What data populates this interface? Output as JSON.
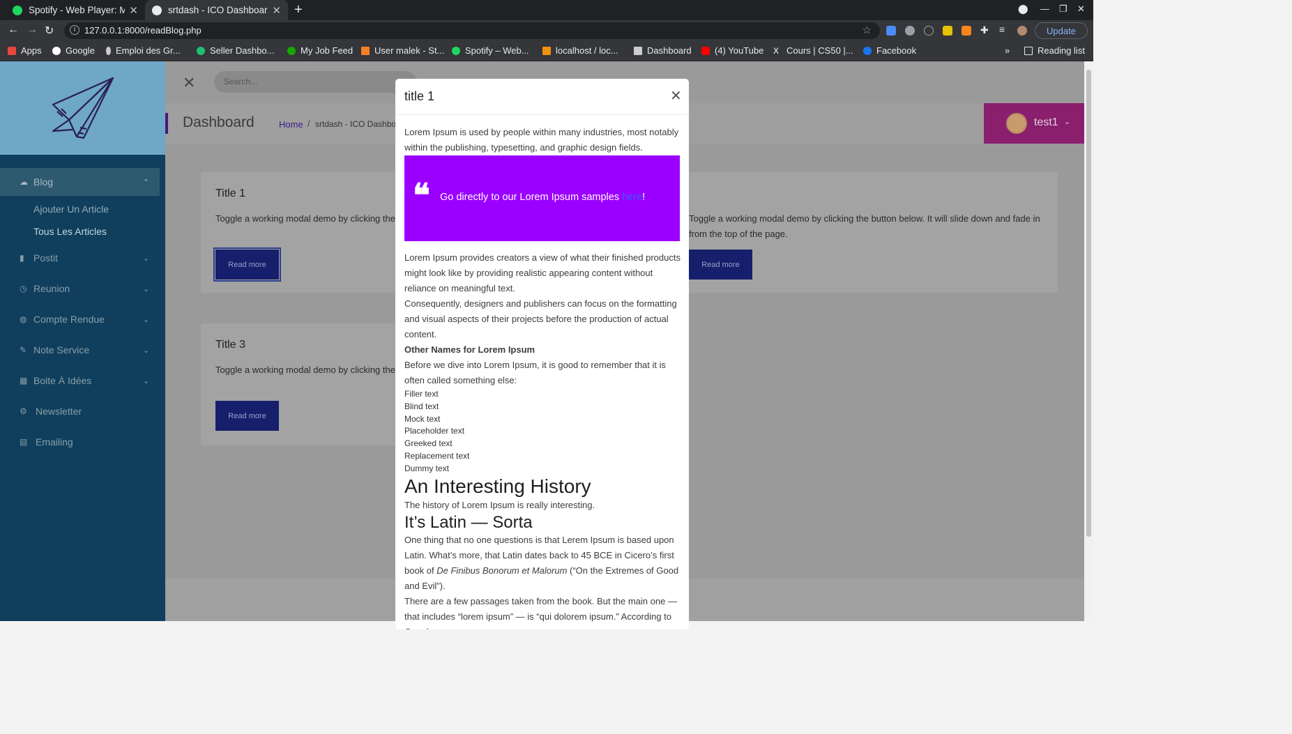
{
  "browser": {
    "tabs": [
      {
        "label": "Spotify - Web Player: Musi",
        "active": false,
        "favicon_color": "#1ed760"
      },
      {
        "label": "srtdash - ICO Dashboard",
        "active": true,
        "favicon_color": "#e8eaed"
      }
    ],
    "url": "127.0.0.1:8000/readBlog.php",
    "update_label": "Update",
    "bookmarks": [
      {
        "label": "Apps",
        "icon_color": "#e8453c"
      },
      {
        "label": "Google",
        "icon_color": "#ffffff"
      },
      {
        "label": "Emploi des Gr...",
        "icon_color": "#cccccc"
      },
      {
        "label": "Seller Dashbo...",
        "icon_color": "#1dbf73"
      },
      {
        "label": "My Job Feed",
        "icon_color": "#14a800"
      },
      {
        "label": "User malek - St...",
        "icon_color": "#f48024"
      },
      {
        "label": "Spotify – Web...",
        "icon_color": "#1ed760"
      },
      {
        "label": "localhost / loc...",
        "icon_color": "#f29111"
      },
      {
        "label": "Dashboard",
        "icon_color": "#cccccc"
      },
      {
        "label": "(4) YouTube",
        "icon_color": "#ff0000"
      },
      {
        "label": "Cours | CS50 |...",
        "icon_color": "#ffffff"
      },
      {
        "label": "Facebook",
        "icon_color": "#1877f2"
      }
    ],
    "reading_list": "Reading list"
  },
  "sidebar": {
    "items": [
      {
        "label": "Blog",
        "icon": "cloud-icon",
        "expanded": true
      },
      {
        "label": "Postit",
        "icon": "bookmark-icon"
      },
      {
        "label": "Reunion",
        "icon": "clock-icon"
      },
      {
        "label": "Compte Rendue",
        "icon": "palette-icon"
      },
      {
        "label": "Note Service",
        "icon": "pen-icon"
      },
      {
        "label": "Boite À Idées",
        "icon": "grid-icon"
      },
      {
        "label": "Newsletter",
        "icon": "gear-icon"
      },
      {
        "label": "Emailing",
        "icon": "list-icon"
      }
    ],
    "blog_subitems": [
      "Ajouter Un Article",
      "Tous Les Articles"
    ]
  },
  "topbar": {
    "search_placeholder": "Search..."
  },
  "pagehead": {
    "title": "Dashboard",
    "breadcrumb_home": "Home",
    "breadcrumb_sep": "/",
    "breadcrumb_current": "srtdash - ICO Dashboa"
  },
  "user": {
    "name": "test1"
  },
  "cards": [
    {
      "title": "Title 1",
      "text": "Toggle a working modal demo by clicking the button below. It will slide down and fade in from the top of the page.",
      "button": "Read more"
    },
    {
      "title": "Title 3",
      "text": "Toggle a working modal demo by clicking the button below. It will slide down and fade in from the top of the page.",
      "button": "Read more"
    },
    {
      "text": "Toggle a working modal demo by clicking the button below. It will slide down and fade in from the top of the page.",
      "button": "Read more"
    }
  ],
  "modal": {
    "title": "title 1",
    "intro": "Lorem Ipsum is used by people within many industries, most notably within the publishing, typesetting, and graphic design fields.",
    "quote_text": "Go directly to our Lorem Ipsum samples ",
    "quote_link": "here",
    "quote_end": "!",
    "p1": "Lorem Ipsum provides creators a view of what their finished products might look like by providing realistic appearing content without reliance on meaningful text.",
    "p2": "Consequently, designers and publishers can focus on the formatting and visual aspects of their projects before the production of actual content.",
    "other_names_heading": "Other Names for Lorem Ipsum",
    "p3": "Before we dive into Lorem Ipsum, it is good to remember that it is often called something else:",
    "names": [
      "Filler text",
      "Blind text",
      "Mock text",
      "Placeholder text",
      "Greeked text",
      "Replacement text",
      "Dummy text"
    ],
    "h_history": "An Interesting History",
    "p_history": "The history of Lorem Ipsum is really interesting.",
    "h_latin": "It’s Latin — Sorta",
    "p_latin_a": "One thing that no one questions is that Lerem Ipsum is based upon Latin. What’s more, that Latin dates back to 45 BCE in Cicero’s first book of ",
    "p_latin_em": "De Finibus Bonorum et Malorum",
    "p_latin_b": " (“On the Extremes of Good and Evil”).",
    "p_last": "There are a few passages taken from the book. But the main one — that includes “lorem ipsum” — is “qui dolorem ipsum.” According to Google"
  },
  "colors": {
    "quote_bg": "#9b00ff",
    "sidebar_bg": "#0f3f5d",
    "button_bg": "#161f6c",
    "user_box": "#8a1f6e"
  }
}
